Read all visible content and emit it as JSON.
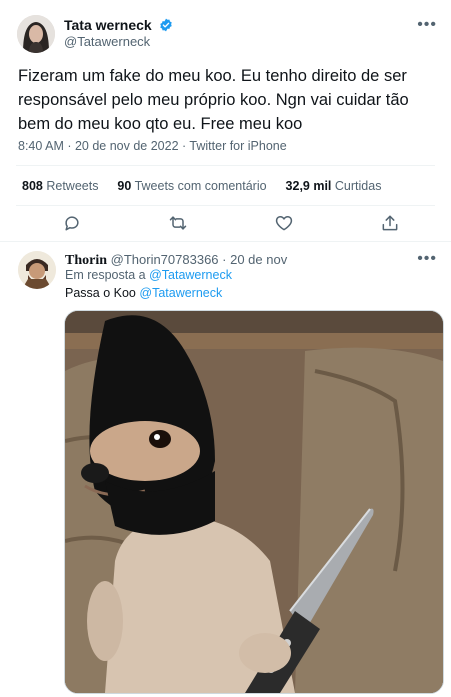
{
  "tweet": {
    "author_name": "Tata werneck",
    "author_handle": "@Tatawerneck",
    "text": "Fizeram um fake do meu koo. Eu tenho direito de ser responsável pelo meu próprio koo. Ngn vai cuidar tão bem do meu koo qto eu. Free meu koo",
    "meta": "8:40 AM · 20 de nov de 2022 · Twitter for iPhone",
    "stats": {
      "retweets_count": "808",
      "retweets_label": "Retweets",
      "quotes_count": "90",
      "quotes_label": "Tweets com comentário",
      "likes_count": "32,9 mil",
      "likes_label": "Curtidas"
    },
    "more_label": "•••"
  },
  "reply": {
    "author_name": "Thorin",
    "author_handle": "@Thorin70783366",
    "date": "· 20 de nov",
    "in_reply_prefix": "Em resposta a",
    "in_reply_handle": "@Tatawerneck",
    "text_prefix": "Passa o Koo",
    "text_mention": "@Tatawerneck",
    "more_label": "•••"
  },
  "icons": {
    "verified": "verified-badge-icon",
    "reply": "comment-icon",
    "retweet": "retweet-icon",
    "like": "heart-icon",
    "share": "share-icon"
  },
  "colors": {
    "accent": "#1d9bf0",
    "text": "#0f1419",
    "muted": "#536471",
    "border": "#eff3f4"
  }
}
